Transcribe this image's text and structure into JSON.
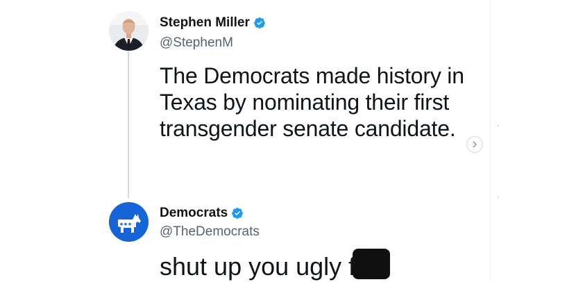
{
  "original_tweet": {
    "author_name": "Stephen Miller",
    "author_handle": "@StephenM",
    "text": "The Democrats made history in Texas by nominating their first transgender senate candidate."
  },
  "reply_tweet": {
    "author_name": "Democrats",
    "author_handle": "@TheDemocrats",
    "text_visible": "shut up you ugly f"
  },
  "icons": {
    "verified": "verified-badge-icon",
    "next": "chevron-right-icon",
    "democrats_logo": "donkey-logo"
  },
  "colors": {
    "verified_blue": "#1d9bf0",
    "democrats_blue": "#1665d8",
    "text_primary": "#0f1419",
    "text_secondary": "#536471",
    "thread_line": "#cfd9de"
  }
}
